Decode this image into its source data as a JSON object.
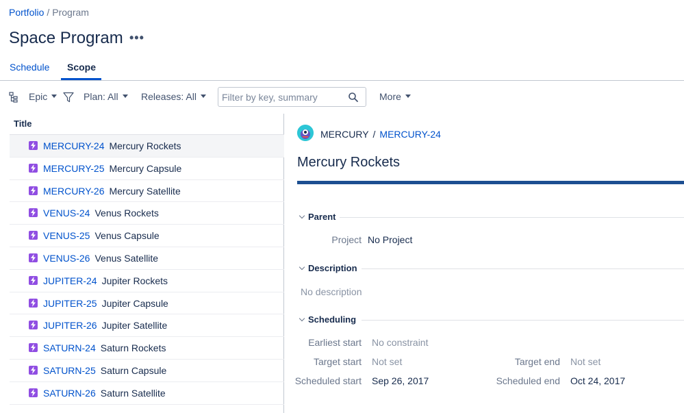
{
  "breadcrumb": {
    "root": "Portfolio",
    "separator": "/",
    "current": "Program"
  },
  "page": {
    "title": "Space Program",
    "more_label": "•••"
  },
  "tabs": [
    {
      "label": "Schedule"
    },
    {
      "label": "Scope",
      "active": true
    }
  ],
  "toolbar": {
    "hierarchy_icon": "hierarchy-icon",
    "group_label": "Epic",
    "filter_icon": "filter-icon",
    "plan_label": "Plan: All",
    "releases_label": "Releases: All",
    "search": {
      "placeholder": "Filter by key, summary",
      "value": ""
    },
    "more_label": "More"
  },
  "list": {
    "header": "Title",
    "items": [
      {
        "key": "MERCURY-24",
        "summary": "Mercury Rockets",
        "selected": true
      },
      {
        "key": "MERCURY-25",
        "summary": "Mercury Capsule"
      },
      {
        "key": "MERCURY-26",
        "summary": "Mercury Satellite"
      },
      {
        "key": "VENUS-24",
        "summary": "Venus Rockets"
      },
      {
        "key": "VENUS-25",
        "summary": "Venus Capsule"
      },
      {
        "key": "VENUS-26",
        "summary": "Venus Satellite"
      },
      {
        "key": "JUPITER-24",
        "summary": "Jupiter Rockets"
      },
      {
        "key": "JUPITER-25",
        "summary": "Jupiter Capsule"
      },
      {
        "key": "JUPITER-26",
        "summary": "Jupiter Satellite"
      },
      {
        "key": "SATURN-24",
        "summary": "Saturn Rockets"
      },
      {
        "key": "SATURN-25",
        "summary": "Saturn Capsule"
      },
      {
        "key": "SATURN-26",
        "summary": "Saturn Satellite"
      }
    ]
  },
  "detail": {
    "project": "MERCURY",
    "separator": "/",
    "issue_key": "MERCURY-24",
    "title": "Mercury Rockets",
    "progress": 1.0,
    "sections": {
      "parent": {
        "heading": "Parent",
        "project_label": "Project",
        "project_value": "No Project"
      },
      "description": {
        "heading": "Description",
        "text": "No description"
      },
      "scheduling": {
        "heading": "Scheduling",
        "earliest_start_label": "Earliest start",
        "earliest_start_value": "No constraint",
        "target_start_label": "Target start",
        "target_start_value": "Not set",
        "target_end_label": "Target end",
        "target_end_value": "Not set",
        "scheduled_start_label": "Scheduled start",
        "scheduled_start_value": "Sep 26, 2017",
        "scheduled_end_label": "Scheduled end",
        "scheduled_end_value": "Oct 24, 2017"
      }
    }
  },
  "colors": {
    "link": "#0052cc",
    "epic": "#904ee2",
    "progress": "#1d4f91",
    "avatar": "#2dc6d6"
  }
}
